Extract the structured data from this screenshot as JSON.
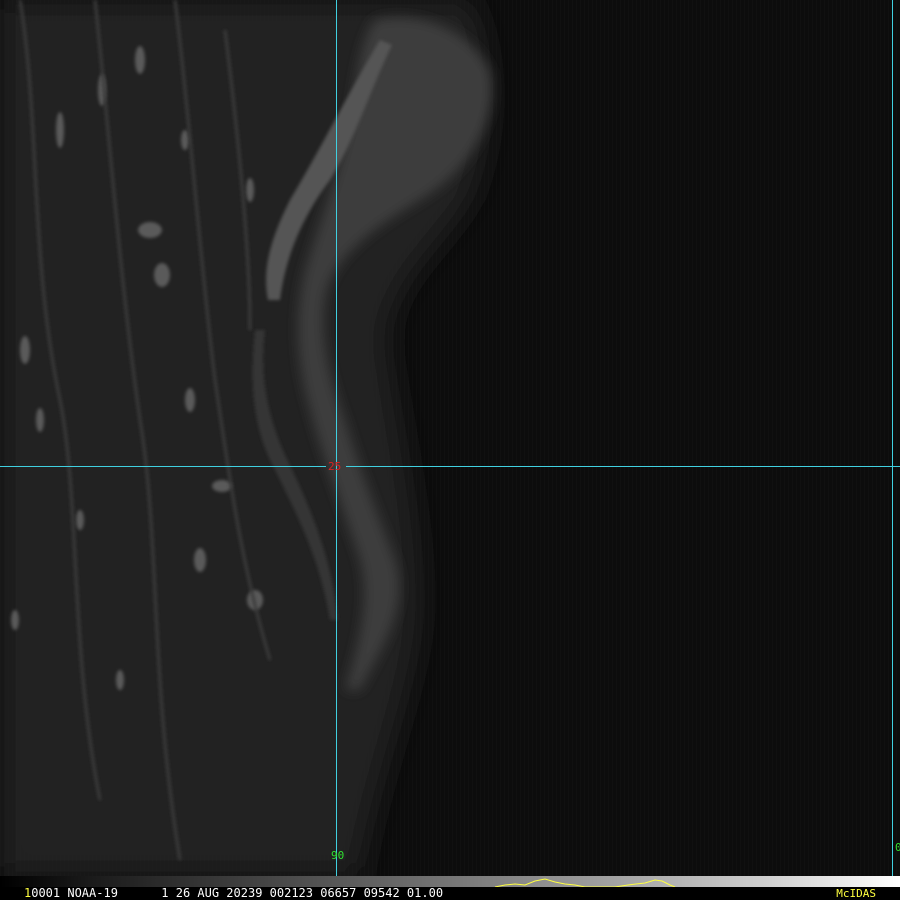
{
  "image": {
    "description_none": "",
    "grid_color": "#40d0e0"
  },
  "grid_labels": {
    "latitude": "25",
    "longitude": "90",
    "edge": "0",
    "latitude_color": "#e02020",
    "longitude_color": "#30e030"
  },
  "info_bar": {
    "frame_number": "1",
    "text": "0001 NOAA-19      1 26 AUG 20239 002123 06657 09542 01.00",
    "brand": "McIDAS",
    "text_color": "#ffffff",
    "brand_color": "#ffff40"
  }
}
